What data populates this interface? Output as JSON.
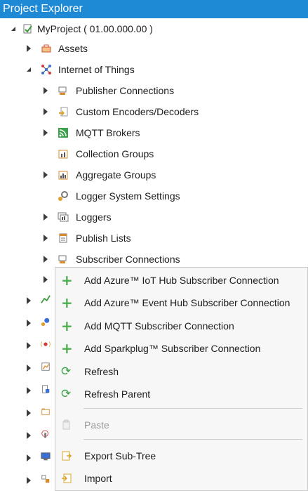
{
  "window": {
    "title": "Project Explorer"
  },
  "tree": {
    "root": {
      "label": "MyProject ( 01.00.000.00 )"
    },
    "assets": {
      "label": "Assets"
    },
    "iot": {
      "label": "Internet of Things"
    },
    "children": [
      {
        "label": "Publisher Connections",
        "icon": "publisher-connection-icon"
      },
      {
        "label": "Custom Encoders/Decoders",
        "icon": "encoder-decoder-icon"
      },
      {
        "label": "MQTT Brokers",
        "icon": "mqtt-broker-icon"
      },
      {
        "label": "Collection Groups",
        "icon": "collection-groups-icon"
      },
      {
        "label": "Aggregate Groups",
        "icon": "aggregate-groups-icon"
      },
      {
        "label": "Logger System Settings",
        "icon": "logger-settings-icon"
      },
      {
        "label": "Loggers",
        "icon": "loggers-icon"
      },
      {
        "label": "Publish Lists",
        "icon": "publish-lists-icon"
      },
      {
        "label": "Subscriber Connections",
        "icon": "subscriber-connection-icon"
      }
    ]
  },
  "context_menu": {
    "items": [
      {
        "label": "Add Azure™ IoT Hub Subscriber Connection",
        "icon": "plus-icon",
        "enabled": true
      },
      {
        "label": "Add Azure™ Event Hub Subscriber Connection",
        "icon": "plus-icon",
        "enabled": true
      },
      {
        "label": "Add MQTT Subscriber Connection",
        "icon": "plus-icon",
        "enabled": true
      },
      {
        "label": "Add Sparkplug™ Subscriber Connection",
        "icon": "plus-icon",
        "enabled": true
      },
      {
        "label": "Refresh",
        "icon": "refresh-icon",
        "enabled": true
      },
      {
        "label": "Refresh Parent",
        "icon": "refresh-icon",
        "enabled": true
      },
      {
        "label": "Paste",
        "icon": "paste-icon",
        "enabled": false
      },
      {
        "label": "Export Sub-Tree",
        "icon": "export-icon",
        "enabled": true
      },
      {
        "label": "Import",
        "icon": "import-icon",
        "enabled": true
      }
    ]
  },
  "colors": {
    "title_bar": "#1e8ad6",
    "selection": "#d6d6d6",
    "menu_bg": "#f7f7f7",
    "accent_green": "#4caf50"
  }
}
